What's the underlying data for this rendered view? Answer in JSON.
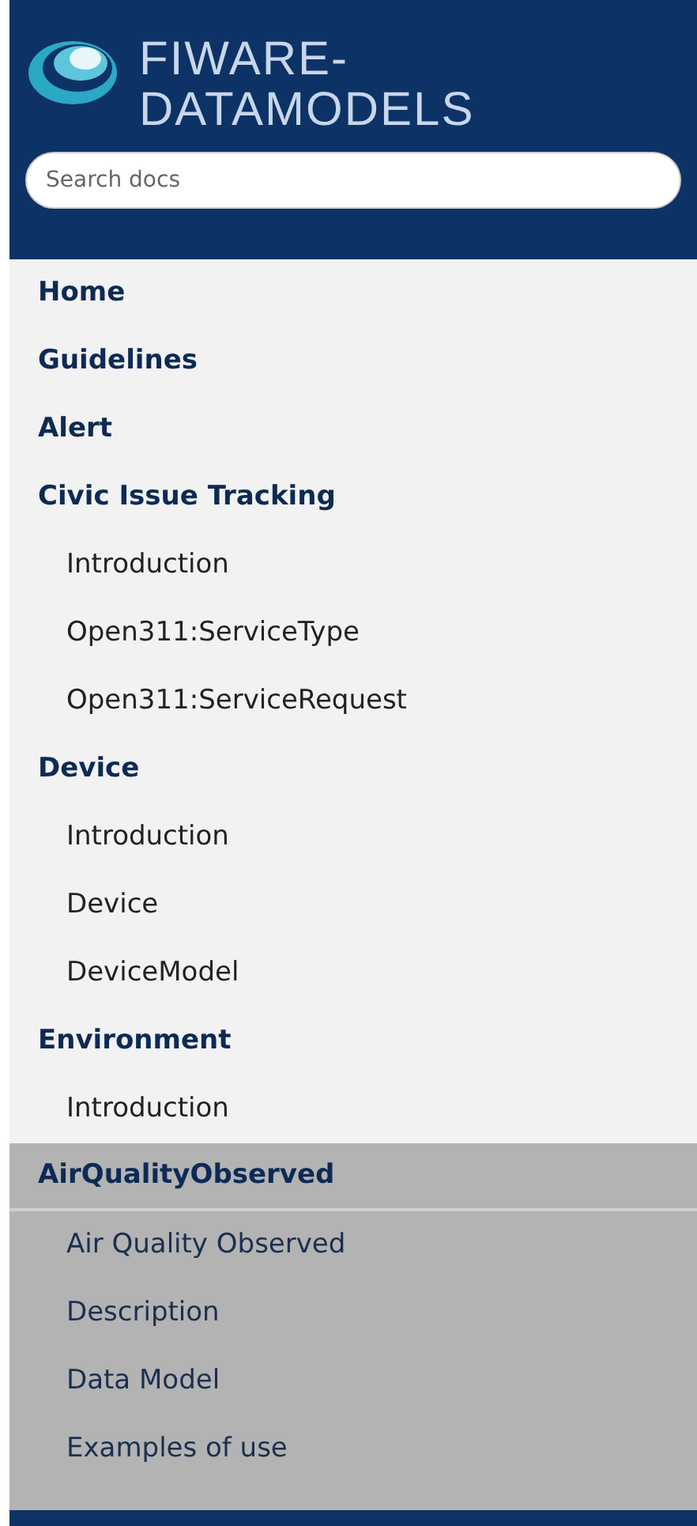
{
  "logo": {
    "line_1": "FIWARE-",
    "line_2": "DATAMODELS"
  },
  "search": {
    "placeholder": "Search docs"
  },
  "nav": [
    {
      "label": "Home",
      "selected": false
    },
    {
      "label": "Guidelines",
      "selected": false
    },
    {
      "label": "Alert",
      "selected": false
    },
    {
      "label": "Civic Issue Tracking",
      "selected": false,
      "children": [
        "Introduction",
        "Open311:ServiceType",
        "Open311:ServiceRequest"
      ]
    },
    {
      "label": "Device",
      "selected": false,
      "children": [
        "Introduction",
        "Device",
        "DeviceModel"
      ]
    },
    {
      "label": "Environment",
      "selected": false,
      "children": [
        "Introduction"
      ]
    },
    {
      "label": "AirQualityObserved",
      "selected": true,
      "children": [
        "Air Quality Observed",
        "Description",
        "Data Model",
        "Examples of use"
      ]
    }
  ]
}
